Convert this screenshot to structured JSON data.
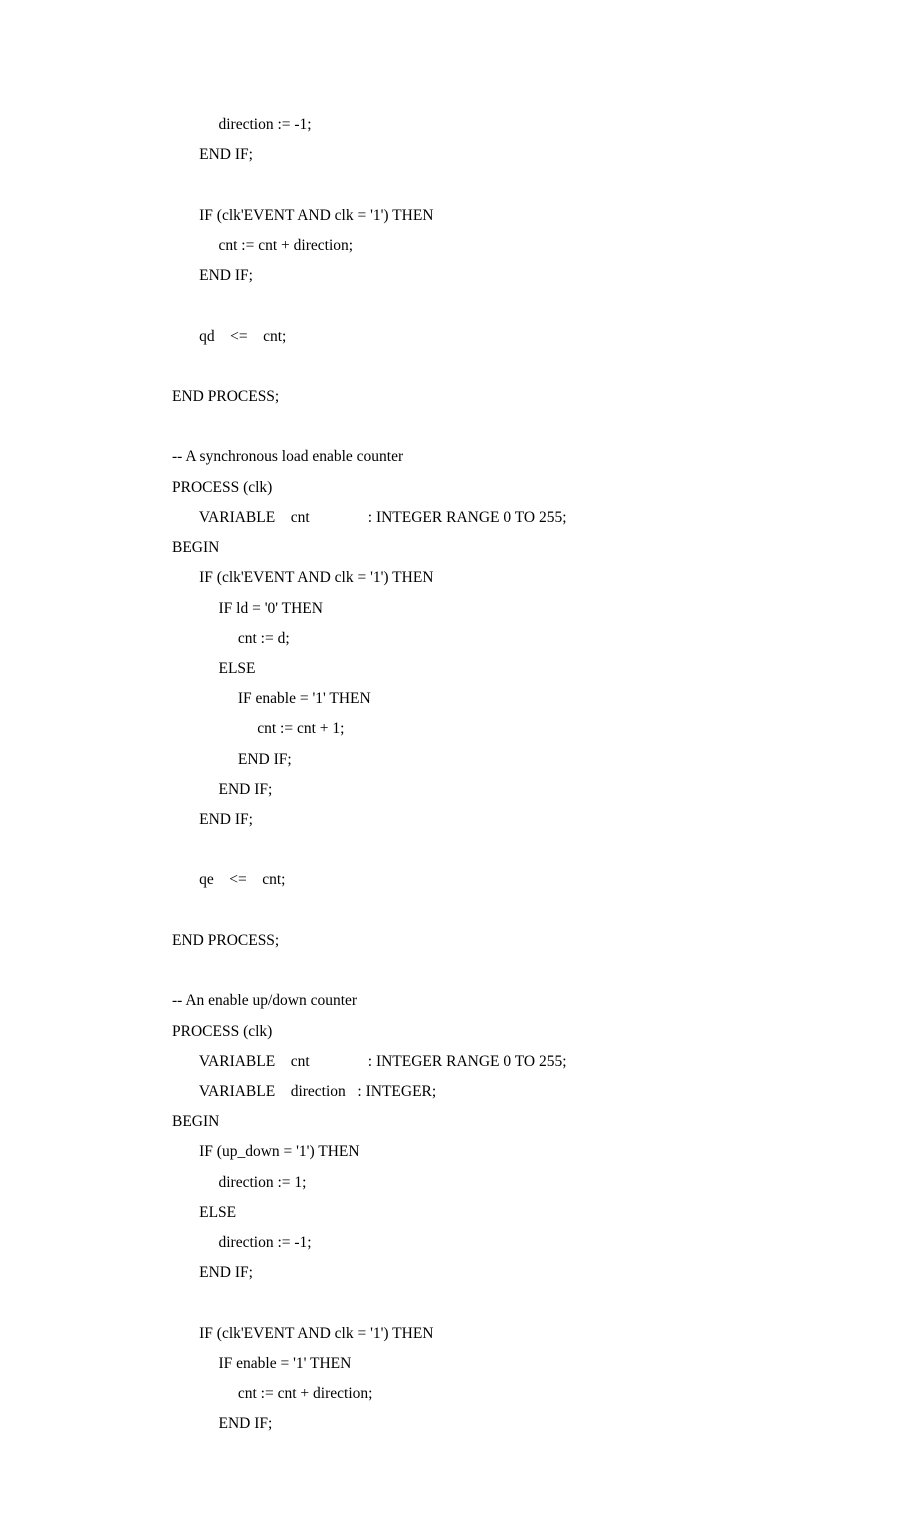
{
  "lines": [
    "            direction := -1;",
    "       END IF;",
    "",
    "       IF (clk'EVENT AND clk = '1') THEN",
    "            cnt := cnt + direction;",
    "       END IF;",
    "",
    "       qd    <=    cnt;",
    "",
    "END PROCESS;",
    "",
    "-- A synchronous load enable counter",
    "PROCESS (clk)",
    "       VARIABLE    cnt               : INTEGER RANGE 0 TO 255;",
    "BEGIN",
    "       IF (clk'EVENT AND clk = '1') THEN",
    "            IF ld = '0' THEN",
    "                 cnt := d;",
    "            ELSE",
    "                 IF enable = '1' THEN",
    "                      cnt := cnt + 1;",
    "                 END IF;",
    "            END IF;",
    "       END IF;",
    "",
    "       qe    <=    cnt;",
    "",
    "END PROCESS;",
    "",
    "-- An enable up/down counter",
    "PROCESS (clk)",
    "       VARIABLE    cnt               : INTEGER RANGE 0 TO 255;",
    "       VARIABLE    direction   : INTEGER;",
    "BEGIN",
    "       IF (up_down = '1') THEN",
    "            direction := 1;",
    "       ELSE",
    "            direction := -1;",
    "       END IF;",
    "",
    "       IF (clk'EVENT AND clk = '1') THEN",
    "            IF enable = '1' THEN",
    "                 cnt := cnt + direction;",
    "            END IF;"
  ]
}
